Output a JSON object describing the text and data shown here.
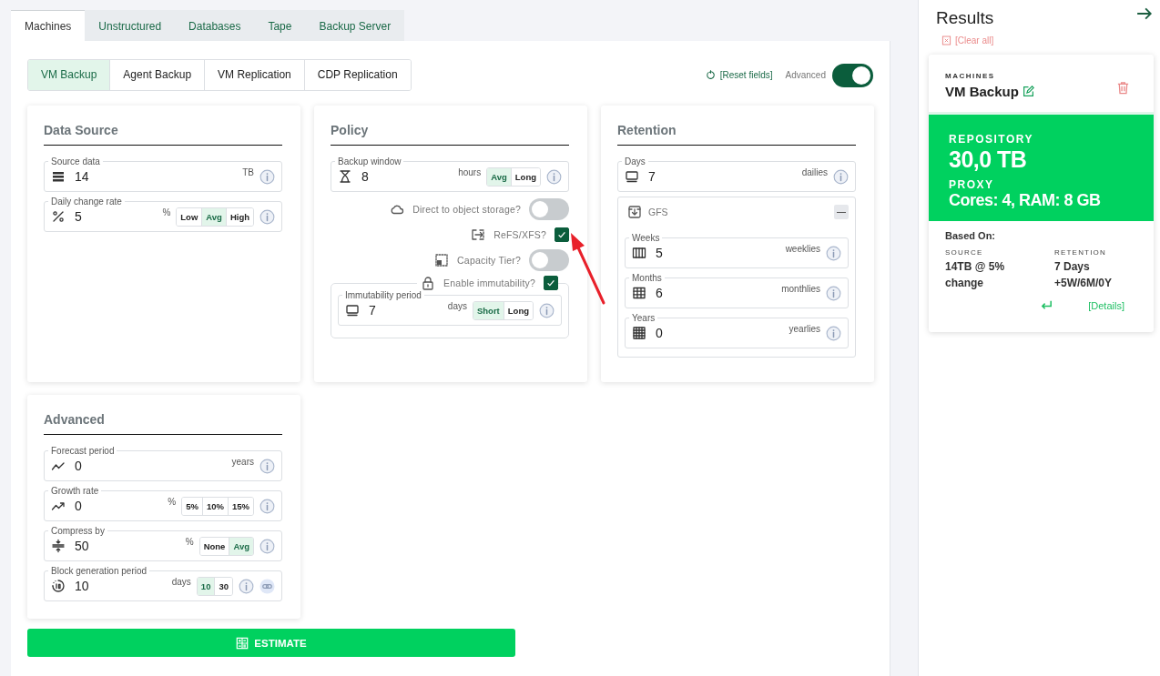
{
  "category_tabs": [
    {
      "label": "Machines",
      "selected": true
    },
    {
      "label": "Unstructured",
      "selected": false
    },
    {
      "label": "Databases",
      "selected": false
    },
    {
      "label": "Tape",
      "selected": false
    },
    {
      "label": "Backup Server",
      "selected": false
    }
  ],
  "job_tabs": [
    {
      "label": "VM Backup",
      "selected": true
    },
    {
      "label": "Agent Backup",
      "selected": false
    },
    {
      "label": "VM Replication",
      "selected": false
    },
    {
      "label": "CDP Replication",
      "selected": false
    }
  ],
  "reset_fields": "[Reset fields]",
  "advanced_switch": {
    "label": "Advanced",
    "on": true
  },
  "data_source": {
    "title": "Data Source",
    "fields": [
      {
        "label": "Source data",
        "value": "14",
        "unit": "TB"
      },
      {
        "label": "Daily change rate",
        "value": "5",
        "unit": "%",
        "options": [
          {
            "label": "Low",
            "selected": false
          },
          {
            "label": "Avg",
            "selected": true
          },
          {
            "label": "High",
            "selected": false
          }
        ]
      }
    ]
  },
  "policy": {
    "title": "Policy",
    "fields": [
      {
        "label": "Backup window",
        "value": "8",
        "unit": "hours",
        "options": [
          {
            "label": "Avg",
            "selected": true
          },
          {
            "label": "Long",
            "selected": false
          }
        ]
      }
    ],
    "options": [
      {
        "kind": "toggle",
        "label": "Direct to object storage?",
        "on": false
      },
      {
        "kind": "checkbox",
        "label": "ReFS/XFS?",
        "checked": true
      },
      {
        "kind": "toggle",
        "label": "Capacity Tier?",
        "on": false
      }
    ],
    "immutability": {
      "label": "Enable immutability?",
      "checked": true,
      "field": {
        "label": "Immutability period",
        "value": "7",
        "unit": "days",
        "options": [
          {
            "label": "Short",
            "selected": true
          },
          {
            "label": "Long",
            "selected": false
          }
        ]
      }
    }
  },
  "retention": {
    "title": "Retention",
    "fields": [
      {
        "label": "Days",
        "value": "7",
        "unit": "dailies"
      }
    ],
    "gfs": {
      "title": "GFS",
      "expanded": true,
      "fields": [
        {
          "label": "Weeks",
          "value": "5",
          "unit": "weeklies"
        },
        {
          "label": "Months",
          "value": "6",
          "unit": "monthlies"
        },
        {
          "label": "Years",
          "value": "0",
          "unit": "yearlies"
        }
      ]
    }
  },
  "advanced": {
    "title": "Advanced",
    "fields": [
      {
        "label": "Forecast period",
        "value": "0",
        "unit": "years"
      },
      {
        "label": "Growth rate",
        "value": "0",
        "unit": "%",
        "options": [
          {
            "label": "5%",
            "selected": false
          },
          {
            "label": "10%",
            "selected": false
          },
          {
            "label": "15%",
            "selected": false
          }
        ]
      },
      {
        "label": "Compress by",
        "value": "50",
        "unit": "%",
        "options": [
          {
            "label": "None",
            "selected": false
          },
          {
            "label": "Avg",
            "selected": true
          }
        ]
      },
      {
        "label": "Block generation period",
        "value": "10",
        "unit": "days",
        "options": [
          {
            "label": "10",
            "selected": true
          },
          {
            "label": "30",
            "selected": false
          }
        ]
      }
    ]
  },
  "estimate_button": "ESTIMATE",
  "results": {
    "title": "Results",
    "clear_all": "[Clear all]",
    "cards": [
      {
        "category": "MACHINES",
        "name": "VM Backup",
        "repository_label": "REPOSITORY",
        "repository": "30,0 TB",
        "proxy_label": "PROXY",
        "proxy": "Cores: 4, RAM: 8 GB",
        "based_on": "Based On:",
        "source_label": "SOURCE",
        "source": "14TB @ 5% change",
        "retention_label": "RETENTION",
        "retention": "7 Days +5W/6M/0Y",
        "details": "[Details]"
      }
    ]
  }
}
